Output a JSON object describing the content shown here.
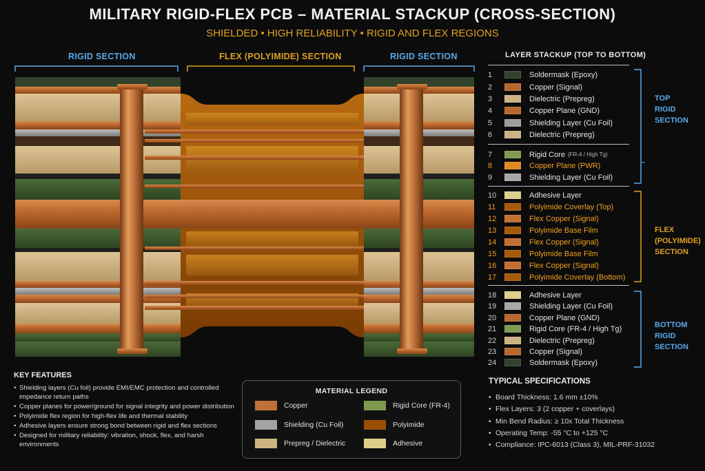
{
  "title": "MILITARY RIGID-FLEX PCB – MATERIAL STACKUP (CROSS-SECTION)",
  "subtitle": "SHIELDED • HIGH RELIABILITY • RIGID AND FLEX REGIONS",
  "sections": {
    "left": "RIGID SECTION",
    "middle": "FLEX (POLYIMIDE) SECTION",
    "right": "RIGID SECTION"
  },
  "stackup": {
    "heading": "LAYER STACKUP (TOP TO BOTTOM)",
    "layers": [
      {
        "num": "1",
        "label": "Soldermask (Epoxy)",
        "color": "#33432b",
        "highlight": false
      },
      {
        "num": "2",
        "label": "Copper (Signal)",
        "color": "#b8682e",
        "highlight": false
      },
      {
        "num": "3",
        "label": "Dielectric (Prepreg)",
        "color": "#cdb384",
        "highlight": false
      },
      {
        "num": "4",
        "label": "Copper Plane (GND)",
        "color": "#b8682e",
        "highlight": false
      },
      {
        "num": "5",
        "label": "Shielding Layer (Cu Foil)",
        "color": "#9c9c9c",
        "highlight": false
      },
      {
        "num": "6",
        "label": "Dielectric (Prepreg)",
        "color": "#cdb384",
        "highlight": false
      },
      {
        "num": "7",
        "label": "Rigid Core",
        "small": "(FR-4 / High Tg)",
        "color": "#7f9a50",
        "highlight": false
      },
      {
        "num": "8",
        "label": "Copper Plane (PWR)",
        "color": "#e08a22",
        "highlight": true
      },
      {
        "num": "9",
        "label": "Shielding Layer (Cu Foil)",
        "color": "#a8a8a8",
        "highlight": false
      },
      {
        "num": "10",
        "label": "Adhesive Layer",
        "color": "#ddd08a",
        "highlight": false
      },
      {
        "num": "11",
        "label": "Polyimide Coverlay (Top)",
        "color": "#a65a08",
        "highlight": true
      },
      {
        "num": "12",
        "label": "Flex Copper (Signal)",
        "color": "#c27032",
        "highlight": true
      },
      {
        "num": "13",
        "label": "Polyimide Base Film",
        "color": "#a65a08",
        "highlight": true
      },
      {
        "num": "14",
        "label": "Flex Copper (Signal)",
        "color": "#c27032",
        "highlight": true
      },
      {
        "num": "15",
        "label": "Polyimide Base Film",
        "color": "#a65a08",
        "highlight": true
      },
      {
        "num": "16",
        "label": "Flex Copper (Signal)",
        "color": "#c27032",
        "highlight": true
      },
      {
        "num": "17",
        "label": "Polyimide Coverlay (Bottom)",
        "color": "#a65a08",
        "highlight": true
      },
      {
        "num": "18",
        "label": "Adhesive Layer",
        "color": "#ddd08a",
        "highlight": false
      },
      {
        "num": "19",
        "label": "Shielding Layer (Cu Foil)",
        "color": "#a8a8a8",
        "highlight": false
      },
      {
        "num": "20",
        "label": "Copper Plane (GND)",
        "color": "#b8682e",
        "highlight": false
      },
      {
        "num": "21",
        "label": "Rigid Core (FR-4 / High Tg)",
        "color": "#7f9a50",
        "highlight": false
      },
      {
        "num": "22",
        "label": "Dielectric (Prepreg)",
        "color": "#cdb384",
        "highlight": false
      },
      {
        "num": "23",
        "label": "Copper (Signal)",
        "color": "#b8682e",
        "highlight": false
      },
      {
        "num": "24",
        "label": "Soldermask (Epoxy)",
        "color": "#33432b",
        "highlight": false
      }
    ],
    "groups": {
      "top": [
        "TOP",
        "RIGID",
        "SECTION"
      ],
      "flex": [
        "FLEX",
        "(POLYIMIDE)",
        "SECTION"
      ],
      "bottom": [
        "BOTTOM",
        "RIGID",
        "SECTION"
      ]
    }
  },
  "key_features": {
    "title": "KEY FEATURES",
    "items": [
      "Shielding layers (Cu foil) provide EMI/EMC protection and controlled impedance return paths",
      "Copper planes for power/ground for signal integrity and power distribution",
      "Polyimide flex region for high-flex life and thermal stability",
      "Adhesive layers ensure strong bond between rigid and flex sections",
      "Designed for military reliability: vibration, shock, flex, and harsh environments"
    ]
  },
  "legend": {
    "title": "MATERIAL LEGEND",
    "items": [
      {
        "label": "Copper",
        "color": "#c0703a"
      },
      {
        "label": "Rigid Core (FR-4)",
        "color": "#7f9a50"
      },
      {
        "label": "Shielding (Cu Foil)",
        "color": "#a3a3a3"
      },
      {
        "label": "Polyimide",
        "color": "#9a4f05"
      },
      {
        "label": "Prepreg / Dielectric",
        "color": "#cfb483"
      },
      {
        "label": "Adhesive",
        "color": "#ddd08a"
      }
    ]
  },
  "specs": {
    "title": "TYPICAL SPECIFICATIONS",
    "items": [
      "Board Thickness: 1.6 mm ±10%",
      "Flex Layers: 3 (2 copper + coverlays)",
      "Min Bend Radius: ≥ 10x Total Thickness",
      "Operating Temp: -55 °C to +125 °C",
      "Compliance: IPC-6013 (Class 3), MIL-PRF-31032"
    ]
  },
  "colors": {
    "rigid_accent": "#5aa9e6",
    "flex_accent": "#e0a21f",
    "soldermask": "#33432b",
    "copper": "#b8682e",
    "prepreg": "#cdb384",
    "shield": "#9c9c9c",
    "core": "#3f5a2e",
    "polyimide": "#9a4f05"
  }
}
